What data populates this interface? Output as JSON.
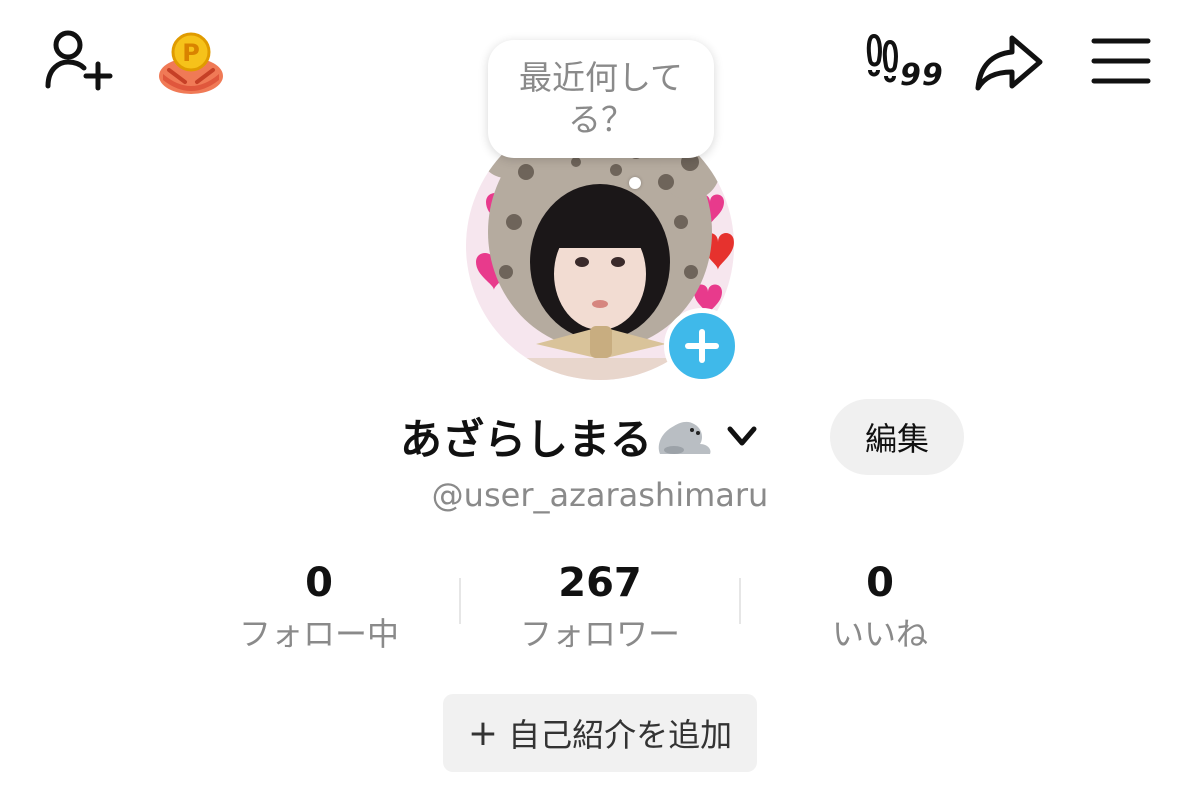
{
  "header": {
    "footprint_count": "99",
    "icons": [
      "add-user-icon",
      "points-reward-icon",
      "footprints-icon",
      "share-icon",
      "menu-icon"
    ]
  },
  "status_bubble": {
    "text": "最近何してる？"
  },
  "profile": {
    "display_name": "あざらしまる",
    "name_emoji": "seal-icon",
    "username": "@user_azarashimaru",
    "edit_label": "編集",
    "avatar_add_icon": "plus-icon"
  },
  "stats": [
    {
      "value": "0",
      "label": "フォロー中"
    },
    {
      "value": "267",
      "label": "フォロワー"
    },
    {
      "value": "0",
      "label": "いいね"
    }
  ],
  "bio": {
    "add_label": "自己紹介を追加"
  },
  "colors": {
    "accent_blue": "#3fb9ea",
    "muted_text": "#8a8a8a",
    "button_bg": "#f0f0f0"
  }
}
